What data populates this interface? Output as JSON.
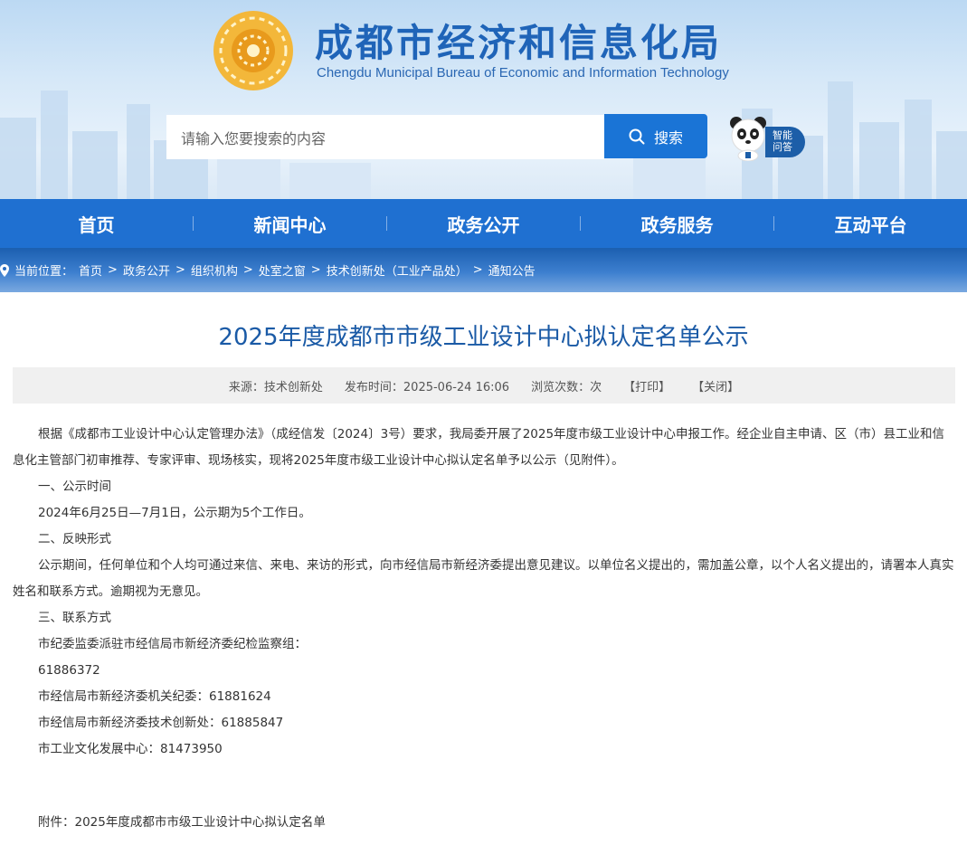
{
  "header": {
    "title": "成都市经济和信息化局",
    "subtitle": "Chengdu Municipal Bureau of Economic and Information Technology",
    "search_placeholder": "请输入您要搜索的内容",
    "search_button": "搜索",
    "assistant_line1": "智能",
    "assistant_line2": "问答"
  },
  "nav": {
    "items": [
      "首页",
      "新闻中心",
      "政务公开",
      "政务服务",
      "互动平台"
    ]
  },
  "breadcrumb": {
    "label": "当前位置：",
    "items": [
      "首页",
      "政务公开",
      "组织机构",
      "处室之窗",
      "技术创新处（工业产品处）",
      "通知公告"
    ],
    "separator": ">"
  },
  "article": {
    "title": "2025年度成都市市级工业设计中心拟认定名单公示",
    "source": "来源：技术创新处",
    "publish_time": "发布时间：2025-06-24 16:06",
    "views": "浏览次数：次",
    "print": "【打印】",
    "close": "【关闭】",
    "paragraphs": [
      "根据《成都市工业设计中心认定管理办法》（成经信发〔2024〕3号）要求，我局委开展了2025年度市级工业设计中心申报工作。经企业自主申请、区（市）县工业和信息化主管部门初审推荐、专家评审、现场核实，现将2025年度市级工业设计中心拟认定名单予以公示（见附件）。",
      "一、公示时间",
      "2024年6月25日—7月1日，公示期为5个工作日。",
      "二、反映形式",
      "公示期间，任何单位和个人均可通过来信、来电、来访的形式，向市经信局市新经济委提出意见建议。以单位名义提出的，需加盖公章，以个人名义提出的，请署本人真实姓名和联系方式。逾期视为无意见。",
      "三、联系方式",
      "市纪委监委派驻市经信局市新经济委纪检监察组：",
      "61886372",
      "市经信局市新经济委机关纪委：61881624",
      "市经信局市新经济委技术创新处：61885847",
      "市工业文化发展中心：81473950"
    ],
    "attachment": "附件：2025年度成都市市级工业设计中心拟认定名单"
  },
  "colors": {
    "primary": "#1f70d1",
    "title_blue": "#1a5aa6",
    "search_button": "#1a74d6"
  }
}
